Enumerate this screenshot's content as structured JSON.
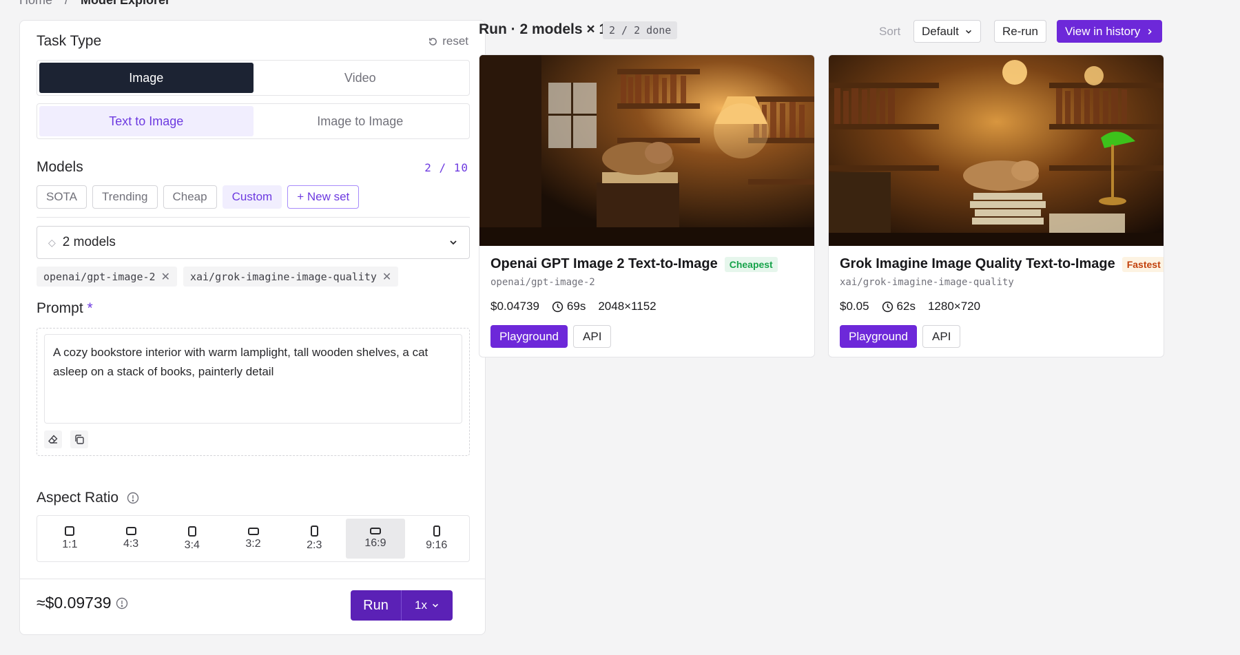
{
  "breadcrumb": {
    "home": "Home",
    "current": "Model Explorer"
  },
  "task": {
    "title": "Task Type",
    "reset": "reset",
    "media": [
      "Image",
      "Video"
    ],
    "mode": [
      "Text to Image",
      "Image to Image"
    ]
  },
  "models": {
    "title": "Models",
    "count": "2 / 10",
    "presets": [
      "SOTA",
      "Trending",
      "Cheap",
      "Custom"
    ],
    "new_set": "+ New set",
    "select_value": "2 models",
    "selected": [
      "openai/gpt-image-2",
      "xai/grok-imagine-image-quality"
    ]
  },
  "prompt": {
    "title": "Prompt",
    "required_mark": "*",
    "text": "A cozy bookstore interior with warm lamplight, tall wooden shelves, a cat asleep on a stack of books, painterly detail"
  },
  "aspect": {
    "title": "Aspect Ratio",
    "options": [
      "1:1",
      "4:3",
      "3:4",
      "3:2",
      "2:3",
      "16:9",
      "9:16"
    ],
    "selected": "16:9"
  },
  "footer": {
    "cost": "≈$0.09739",
    "run": "Run",
    "multiplier": "1x"
  },
  "results": {
    "title": "Run · 2 models × 1",
    "status": "2 / 2 done",
    "sort_label": "Sort",
    "sort_value": "Default",
    "rerun": "Re-run",
    "history": "View in history",
    "cards": [
      {
        "name": "Openai GPT Image 2 Text-to-Image",
        "badge": "Cheapest",
        "slug": "openai/gpt-image-2",
        "price": "$0.04739",
        "time": "69s",
        "size": "2048×1152",
        "playground": "Playground",
        "api": "API"
      },
      {
        "name": "Grok Imagine Image Quality Text-to-Image",
        "badge": "Fastest",
        "slug": "xai/grok-imagine-image-quality",
        "price": "$0.05",
        "time": "62s",
        "size": "1280×720",
        "playground": "Playground",
        "api": "API"
      }
    ]
  },
  "colors": {
    "accent": "#6d28d9",
    "dark": "#1c2333",
    "cheapest": "#16a34a",
    "fastest": "#c2410c"
  }
}
